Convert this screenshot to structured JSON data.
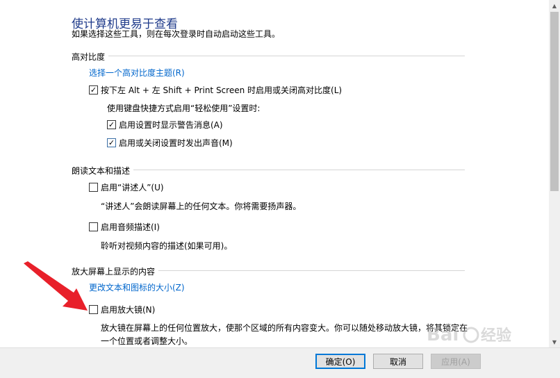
{
  "header": {
    "title": "使计算机更易于查看",
    "subtitle": "如果选择这些工具，则在每次登录时自动启动这些工具。"
  },
  "high_contrast": {
    "header": "高对比度",
    "theme_link": "选择一个高对比度主题(R)",
    "shortcut_toggle": "按下左 Alt + 左 Shift + Print Screen 时启用或关闭高对比度(L)",
    "shortcut_note": "使用键盘快捷方式启用“轻松使用”设置时:",
    "warning_option": "启用设置时显示警告消息(A)",
    "sound_option": "启用或关闭设置时发出声音(M)"
  },
  "narrator": {
    "header": "朗读文本和描述",
    "enable_narrator": "启用“讲述人”(U)",
    "narrator_desc": "“讲述人”会朗读屏幕上的任何文本。你将需要扬声器。",
    "audio_desc": "启用音频描述(I)",
    "audio_desc_note": "聆听对视频内容的描述(如果可用)。"
  },
  "magnifier": {
    "header": "放大屏幕上显示的内容",
    "resize_link": "更改文本和图标的大小(Z)",
    "enable_magnifier": "启用放大镜(N)",
    "magnifier_desc_line1": "放大镜在屏幕上的任何位置放大，使那个区域的所有内容变大。你可以随处移动放大镜，将其锁定在",
    "magnifier_desc_line2": "一个位置或者调整大小。"
  },
  "buttons": {
    "ok": "确定(O)",
    "cancel": "取消",
    "apply": "应用(A)"
  },
  "states": {
    "shortcut_toggle_checked": true,
    "warning_option_checked": true,
    "sound_option_checked": true,
    "enable_narrator_checked": false,
    "audio_desc_checked": false,
    "enable_magnifier_checked": false
  },
  "colors": {
    "title": "#1e3a8a",
    "link": "#0066cc",
    "annotation_arrow": "#e8202a"
  }
}
